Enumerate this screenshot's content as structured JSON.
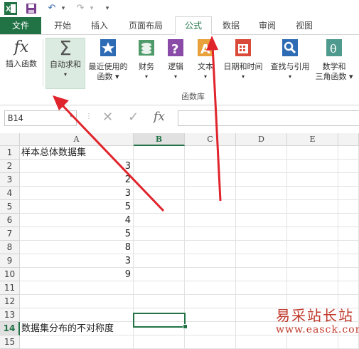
{
  "menu_tabs": [
    "文件",
    "开始",
    "插入",
    "页面布局",
    "公式",
    "数据",
    "审阅",
    "视图"
  ],
  "ribbon": {
    "insert_function": "插入函数",
    "autosum": "自动求和",
    "recent": "最近使用的",
    "recent2": "函数",
    "financial": "财务",
    "logical": "逻辑",
    "text": "文本",
    "datetime": "日期和时间",
    "lookup": "查找与引用",
    "math": "数学和",
    "math2": "三角函数",
    "group_label": "函数库",
    "fx": "fx"
  },
  "formula_bar": {
    "name_box": "B14",
    "fx": "fx",
    "value": ""
  },
  "columns": [
    "A",
    "B",
    "C",
    "D",
    "E"
  ],
  "rows": [
    {
      "n": "1",
      "a": "样本总体数据集"
    },
    {
      "n": "2",
      "a": "3"
    },
    {
      "n": "3",
      "a": "2"
    },
    {
      "n": "4",
      "a": "3"
    },
    {
      "n": "5",
      "a": "5"
    },
    {
      "n": "6",
      "a": "4"
    },
    {
      "n": "7",
      "a": "5"
    },
    {
      "n": "8",
      "a": "8"
    },
    {
      "n": "9",
      "a": "3"
    },
    {
      "n": "10",
      "a": "9"
    },
    {
      "n": "11",
      "a": ""
    },
    {
      "n": "12",
      "a": ""
    },
    {
      "n": "13",
      "a": ""
    },
    {
      "n": "14",
      "a": "数据集分布的不对称度"
    },
    {
      "n": "15",
      "a": ""
    }
  ],
  "watermark": {
    "line1": "易采站长站",
    "line2": "www.easck.com"
  },
  "colors": {
    "excel_green": "#217346",
    "arrow_red": "#e0242c"
  }
}
